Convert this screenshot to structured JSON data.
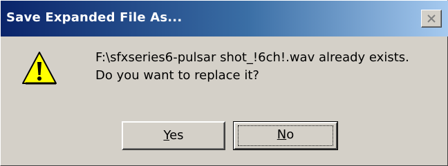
{
  "window": {
    "title": "Save Expanded File As...",
    "titlebar_colors": [
      "#0a246a",
      "#3a6ea5",
      "#a6caf0"
    ],
    "face_color": "#d4d0c8"
  },
  "title_controls": {
    "close_icon": "close-icon"
  },
  "dialog": {
    "icon": "warning-icon",
    "icon_color": "#ffff00",
    "message_line1": "F:\\sfxseries6-pulsar shot_!6ch!.wav already exists.",
    "message_line2": "Do you want to replace it?"
  },
  "buttons": {
    "yes": {
      "accel": "Y",
      "rest": "es"
    },
    "no": {
      "accel": "N",
      "rest": "o",
      "default": true
    }
  }
}
